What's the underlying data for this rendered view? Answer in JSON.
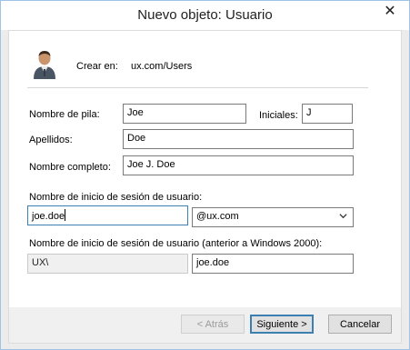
{
  "window": {
    "title": "Nuevo objeto: Usuario",
    "close_glyph": "✕"
  },
  "header": {
    "icon": "user-icon",
    "create_in_label": "Crear en:",
    "create_in_value": "ux.com/Users"
  },
  "form": {
    "first_name_label": "Nombre de pila:",
    "first_name_value": "Joe",
    "initials_label": "Iniciales:",
    "initials_value": "J",
    "last_name_label": "Apellidos:",
    "last_name_value": "Doe",
    "full_name_label": "Nombre completo:",
    "full_name_value": "Joe J. Doe",
    "logon_label": "Nombre de inicio de sesión de usuario:",
    "logon_value": "joe.doe",
    "domain_selected": "@ux.com",
    "legacy_logon_label": "Nombre de inicio de sesión de usuario (anterior a Windows 2000):",
    "legacy_domain_value": "UX\\",
    "legacy_logon_value": "joe.doe"
  },
  "buttons": {
    "back_label": "< Atrás",
    "next_label": "Siguiente >",
    "cancel_label": "Cancelar"
  },
  "colors": {
    "window_border": "#9fc2e5",
    "focus_border": "#3c7fb1"
  }
}
